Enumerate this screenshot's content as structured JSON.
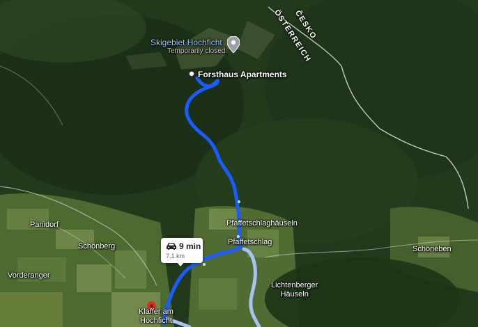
{
  "poi": {
    "name": "Skigebiet Hochficht",
    "status": "Temporarily closed"
  },
  "destination": {
    "name": "Forsthaus Apartments"
  },
  "borders": {
    "country_north": "ČESKO",
    "country_south": "ÖSTERREICH"
  },
  "places": {
    "panidorf": "Panidorf",
    "schoenberg": "Schönberg",
    "vorderanger": "Vorderanger",
    "pfaffetschlaghaeuseln": "Pfaffetschlaghäuseln",
    "pfaffetschlag": "Pfaffetschlag",
    "lichtenberger": "Lichtenberger\nHäuseln",
    "schoeneben": "Schöneben",
    "origin": "Klaffer am\nHochficht"
  },
  "route": {
    "duration": "9 min",
    "distance": "7,1 km",
    "mode_icon": "car-icon",
    "route_color": "#1a5cff",
    "alt_route_color": "#a9c2f5"
  },
  "colors": {
    "forest": "#1f3a1a",
    "farmland": "#5f7a3e",
    "pin_red": "#d93025"
  }
}
